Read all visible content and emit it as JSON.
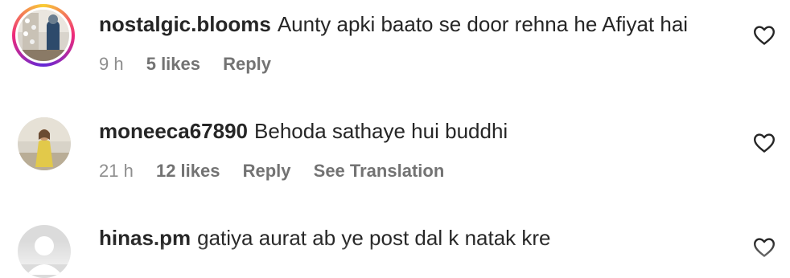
{
  "comments": [
    {
      "username": "nostalgic.blooms",
      "text": "Aunty apki baato se door rehna he Afiyat hai",
      "time": "9 h",
      "likes": "5 likes",
      "reply": "Reply",
      "avatar_icon": "profile-photo-story-ring",
      "like_icon": "heart-outline-icon"
    },
    {
      "username": "moneeca67890",
      "text": "Behoda sathaye hui buddhi",
      "time": "21 h",
      "likes": "12 likes",
      "reply": "Reply",
      "translate": "See Translation",
      "avatar_icon": "profile-photo",
      "like_icon": "heart-outline-icon"
    },
    {
      "username": "hinas.pm",
      "text": "gatiya aurat ab ye post dal k natak kre",
      "avatar_icon": "default-avatar-icon",
      "like_icon": "heart-outline-icon"
    }
  ],
  "colors": {
    "text": "#262626",
    "meta": "#8e8e8e",
    "story_ring_start": "#f9ce34",
    "story_ring_mid": "#ee2a7b",
    "story_ring_end": "#6228d7"
  }
}
